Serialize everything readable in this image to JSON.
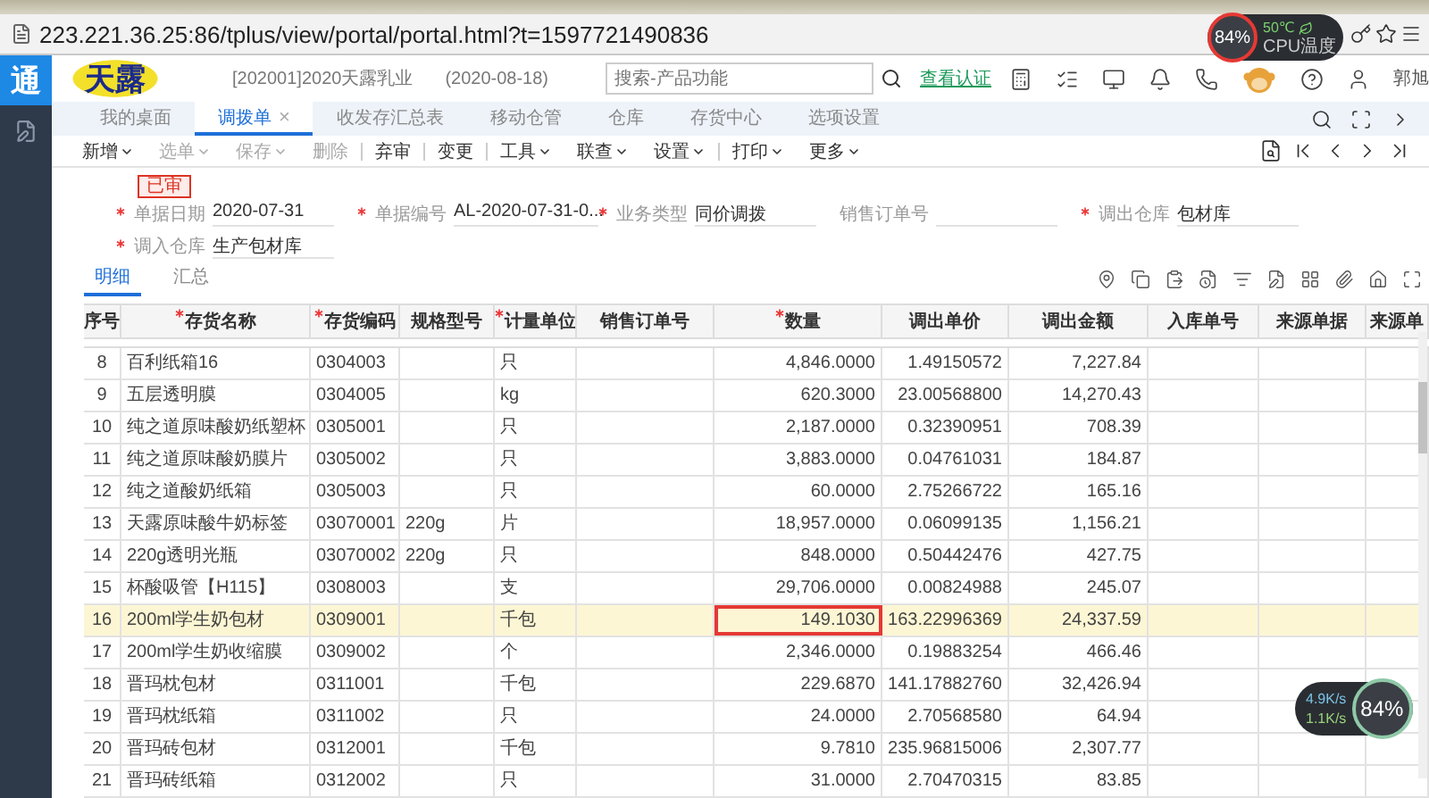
{
  "browser": {
    "url": "223.221.36.25:86/tplus/view/portal/portal.html?t=1597721490836"
  },
  "sidebar": {
    "logo": "通"
  },
  "header": {
    "logo_text": "天露",
    "company": "[202001]2020天露乳业",
    "date": "(2020-08-18)",
    "search": {
      "placeholder": "搜索-产品功能"
    },
    "link": "查看认证",
    "user": "郭旭"
  },
  "tabs": [
    {
      "label": "我的桌面",
      "selected": false
    },
    {
      "label": "调拨单",
      "selected": true,
      "close": "×"
    },
    {
      "label": "收发存汇总表",
      "selected": false
    },
    {
      "label": "移动仓管",
      "selected": false
    },
    {
      "label": "仓库",
      "selected": false
    },
    {
      "label": "存货中心",
      "selected": false
    },
    {
      "label": "选项设置",
      "selected": false
    }
  ],
  "toolbar": [
    {
      "label": "新增",
      "disabled": false,
      "dropdown": true,
      "separator_before": false
    },
    {
      "label": "选单",
      "disabled": true,
      "dropdown": true,
      "separator_before": false
    },
    {
      "label": "保存",
      "disabled": true,
      "dropdown": true,
      "separator_before": false
    },
    {
      "label": "删除",
      "disabled": true,
      "dropdown": false,
      "separator_before": false
    },
    {
      "label": "弃审",
      "disabled": false,
      "dropdown": false,
      "separator_before": true
    },
    {
      "label": "变更",
      "disabled": false,
      "dropdown": false,
      "separator_before": true
    },
    {
      "label": "工具",
      "disabled": false,
      "dropdown": true,
      "separator_before": true
    },
    {
      "label": "联查",
      "disabled": false,
      "dropdown": true,
      "separator_before": false
    },
    {
      "label": "设置",
      "disabled": false,
      "dropdown": true,
      "separator_before": false
    },
    {
      "label": "打印",
      "disabled": false,
      "dropdown": true,
      "separator_before": true
    },
    {
      "label": "更多",
      "disabled": false,
      "dropdown": true,
      "separator_before": false
    }
  ],
  "status_stamp": "已审",
  "form": [
    {
      "label": "单据日期",
      "required": true,
      "value": "2020-07-31"
    },
    {
      "label": "单据编号",
      "required": true,
      "value": "AL-2020-07-31-0..."
    },
    {
      "label": "业务类型",
      "required": true,
      "value": "同价调拨"
    },
    {
      "label": "销售订单号",
      "required": false
    },
    {
      "label": "调出仓库",
      "required": true,
      "value": "包材库"
    },
    {
      "label": "调入仓库",
      "required": true,
      "value": "生产包材库"
    }
  ],
  "detail_tabs": [
    {
      "label": "明细",
      "selected": true
    },
    {
      "label": "汇总",
      "selected": false
    }
  ],
  "table": {
    "columns": [
      {
        "label": "序号",
        "required": false,
        "kind": "index"
      },
      {
        "label": "存货名称",
        "required": true,
        "kind": "text"
      },
      {
        "label": "存货编码",
        "required": true,
        "kind": "text"
      },
      {
        "label": "规格型号",
        "required": false,
        "kind": "text"
      },
      {
        "label": "计量单位",
        "required": true,
        "kind": "text"
      },
      {
        "label": "销售订单号",
        "required": false,
        "kind": "text"
      },
      {
        "label": "数量",
        "required": true,
        "kind": "quantity"
      },
      {
        "label": "调出单价",
        "required": false,
        "kind": "number"
      },
      {
        "label": "调出金额",
        "required": false,
        "kind": "number"
      },
      {
        "label": "入库单号",
        "required": false,
        "kind": "text"
      },
      {
        "label": "来源单据",
        "required": false,
        "kind": "text"
      },
      {
        "label": "来源单",
        "required": false,
        "kind": "text"
      }
    ],
    "rows": [
      {
        "selected": false,
        "editing": false,
        "cells": [
          "8",
          "百利纸箱16",
          "0304003",
          "",
          "只",
          "",
          "4,846.0000",
          "1.49150572",
          "7,227.84",
          "",
          "",
          ""
        ]
      },
      {
        "selected": false,
        "editing": false,
        "cells": [
          "9",
          "五层透明膜",
          "0304005",
          "",
          "kg",
          "",
          "620.3000",
          "23.00568800",
          "14,270.43",
          "",
          "",
          ""
        ]
      },
      {
        "selected": false,
        "editing": false,
        "cells": [
          "10",
          "纯之道原味酸奶纸塑杯",
          "0305001",
          "",
          "只",
          "",
          "2,187.0000",
          "0.32390951",
          "708.39",
          "",
          "",
          ""
        ]
      },
      {
        "selected": false,
        "editing": false,
        "cells": [
          "11",
          "纯之道原味酸奶膜片",
          "0305002",
          "",
          "只",
          "",
          "3,883.0000",
          "0.04761031",
          "184.87",
          "",
          "",
          ""
        ]
      },
      {
        "selected": false,
        "editing": false,
        "cells": [
          "12",
          "纯之道酸奶纸箱",
          "0305003",
          "",
          "只",
          "",
          "60.0000",
          "2.75266722",
          "165.16",
          "",
          "",
          ""
        ]
      },
      {
        "selected": false,
        "editing": false,
        "cells": [
          "13",
          "天露原味酸牛奶标签",
          "03070001",
          "220g",
          "片",
          "",
          "18,957.0000",
          "0.06099135",
          "1,156.21",
          "",
          "",
          ""
        ]
      },
      {
        "selected": false,
        "editing": false,
        "cells": [
          "14",
          "220g透明光瓶",
          "03070002",
          "220g",
          "只",
          "",
          "848.0000",
          "0.50442476",
          "427.75",
          "",
          "",
          ""
        ]
      },
      {
        "selected": false,
        "editing": false,
        "cells": [
          "15",
          "杯酸吸管【H115】",
          "0308003",
          "",
          "支",
          "",
          "29,706.0000",
          "0.00824988",
          "245.07",
          "",
          "",
          ""
        ]
      },
      {
        "selected": true,
        "editing": true,
        "cells": [
          "16",
          "200ml学生奶包材",
          "0309001",
          "",
          "千包",
          "",
          "149.1030",
          "163.22996369",
          "24,337.59",
          "",
          "",
          ""
        ]
      },
      {
        "selected": false,
        "editing": false,
        "cells": [
          "17",
          "200ml学生奶收缩膜",
          "0309002",
          "",
          "个",
          "",
          "2,346.0000",
          "0.19883254",
          "466.46",
          "",
          "",
          ""
        ]
      },
      {
        "selected": false,
        "editing": false,
        "cells": [
          "18",
          "晋玛枕包材",
          "0311001",
          "",
          "千包",
          "",
          "229.6870",
          "141.17882760",
          "32,426.94",
          "",
          "",
          ""
        ]
      },
      {
        "selected": false,
        "editing": false,
        "cells": [
          "19",
          "晋玛枕纸箱",
          "0311002",
          "",
          "只",
          "",
          "24.0000",
          "2.70568580",
          "64.94",
          "",
          "",
          ""
        ]
      },
      {
        "selected": false,
        "editing": false,
        "cells": [
          "20",
          "晋玛砖包材",
          "0312001",
          "",
          "千包",
          "",
          "9.7810",
          "235.96815006",
          "2,307.77",
          "",
          "",
          ""
        ]
      },
      {
        "selected": false,
        "editing": false,
        "cells": [
          "21",
          "晋玛砖纸箱",
          "0312002",
          "",
          "只",
          "",
          "31.0000",
          "2.70470315",
          "83.85",
          "",
          "",
          ""
        ]
      }
    ]
  },
  "cpu_monitor": {
    "usage": "84%",
    "temperature": "50℃",
    "label": "CPU温度"
  },
  "network_monitor": {
    "upload": "4.9K/s",
    "download": "1.1K/s",
    "usage": "84%"
  }
}
